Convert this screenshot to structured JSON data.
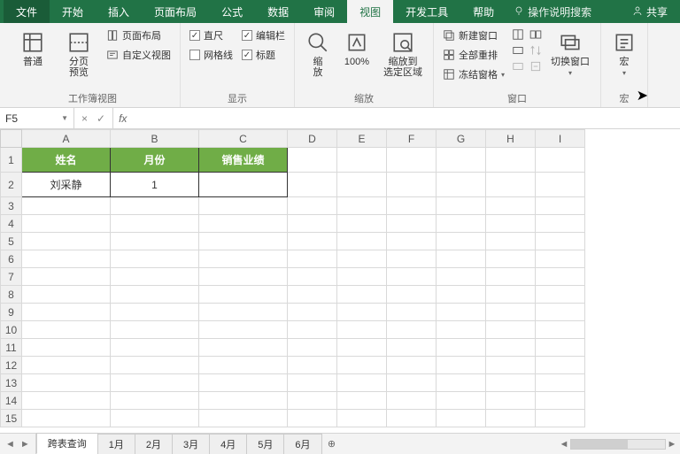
{
  "tabs": {
    "file": "文件",
    "items": [
      "开始",
      "插入",
      "页面布局",
      "公式",
      "数据",
      "审阅",
      "视图",
      "开发工具",
      "帮助"
    ],
    "active_index": 6,
    "search_placeholder": "操作说明搜索",
    "share": "共享"
  },
  "ribbon": {
    "groups": {
      "workbook_views": {
        "label": "工作簿视图",
        "normal": "普通",
        "page_break": "分页\n预览",
        "page_layout": "页面布局",
        "custom_view": "自定义视图"
      },
      "show": {
        "label": "显示",
        "ruler": "直尺",
        "gridlines": "网格线",
        "formula_bar": "编辑栏",
        "headings": "标题",
        "ruler_checked": true,
        "gridlines_checked": false,
        "formula_bar_checked": true,
        "headings_checked": true
      },
      "zoom": {
        "label": "缩放",
        "zoom": "缩\n放",
        "p100": "100%",
        "zoom_selection": "缩放到\n选定区域"
      },
      "window": {
        "label": "窗口",
        "new_window": "新建窗口",
        "arrange_all": "全部重排",
        "freeze": "冻结窗格",
        "switch": "切换窗口"
      },
      "macros": {
        "label": "宏",
        "macros": "宏"
      }
    }
  },
  "formula_bar": {
    "name_box": "F5",
    "cancel_glyph": "×",
    "enter_glyph": "✓",
    "fx_glyph": "fx",
    "value": ""
  },
  "columns": [
    "A",
    "B",
    "C",
    "D",
    "E",
    "F",
    "G",
    "H",
    "I"
  ],
  "rows": [
    "1",
    "2",
    "3",
    "4",
    "5",
    "6",
    "7",
    "8",
    "9",
    "10",
    "11",
    "12",
    "13",
    "14",
    "15"
  ],
  "table": {
    "headers": [
      "姓名",
      "月份",
      "销售业绩"
    ],
    "data_row": [
      "刘采静",
      "1",
      ""
    ]
  },
  "sheet_tabs": {
    "tabs": [
      "跨表查询",
      "1月",
      "2月",
      "3月",
      "4月",
      "5月",
      "6月"
    ],
    "active_index": 0,
    "add_glyph": "⊕"
  },
  "chart_data": {
    "type": "table",
    "title": "",
    "columns": [
      "姓名",
      "月份",
      "销售业绩"
    ],
    "rows": [
      {
        "姓名": "刘采静",
        "月份": 1,
        "销售业绩": null
      }
    ]
  }
}
